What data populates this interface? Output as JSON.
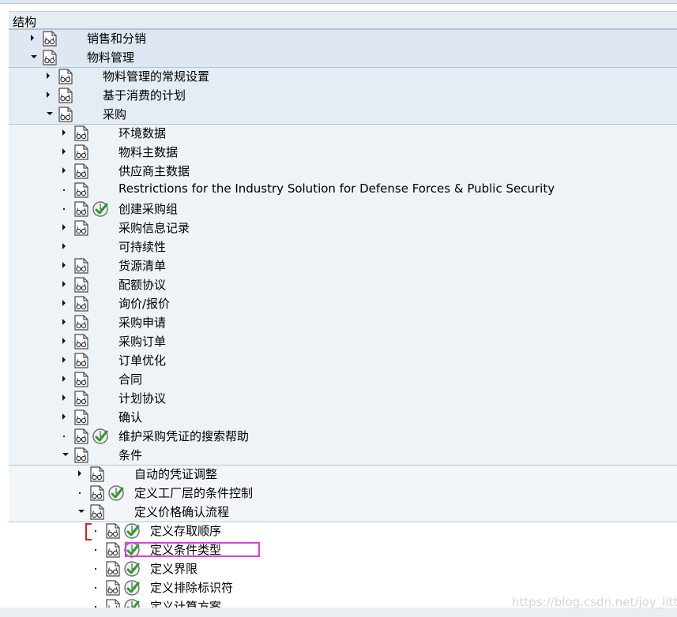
{
  "header": {
    "title": "结构"
  },
  "tree": [
    {
      "label": "销售和分销",
      "level": 0,
      "state": "collapsed",
      "check": false
    },
    {
      "label": "物料管理",
      "level": 0,
      "state": "expanded",
      "check": false
    },
    {
      "label": "物料管理的常规设置",
      "level": 1,
      "state": "collapsed",
      "check": false
    },
    {
      "label": "基于消费的计划",
      "level": 1,
      "state": "collapsed",
      "check": false
    },
    {
      "label": "采购",
      "level": 1,
      "state": "expanded",
      "check": false
    },
    {
      "label": "环境数据",
      "level": 2,
      "state": "collapsed",
      "check": false
    },
    {
      "label": "物料主数据",
      "level": 2,
      "state": "collapsed",
      "check": false
    },
    {
      "label": "供应商主数据",
      "level": 2,
      "state": "collapsed",
      "check": false
    },
    {
      "label": "Restrictions for the Industry Solution for Defense Forces & Public Security",
      "level": 2,
      "state": "leaf",
      "check": false
    },
    {
      "label": "创建采购组",
      "level": 2,
      "state": "leaf",
      "check": true
    },
    {
      "label": "采购信息记录",
      "level": 2,
      "state": "collapsed",
      "check": false
    },
    {
      "label": "可持续性",
      "level": 2,
      "state": "collapsed",
      "check": false,
      "noicon": true
    },
    {
      "label": "货源清单",
      "level": 2,
      "state": "collapsed",
      "check": false
    },
    {
      "label": "配额协议",
      "level": 2,
      "state": "collapsed",
      "check": false
    },
    {
      "label": "询价/报价",
      "level": 2,
      "state": "collapsed",
      "check": false
    },
    {
      "label": "采购申请",
      "level": 2,
      "state": "collapsed",
      "check": false
    },
    {
      "label": "采购订单",
      "level": 2,
      "state": "collapsed",
      "check": false
    },
    {
      "label": "订单优化",
      "level": 2,
      "state": "collapsed",
      "check": false
    },
    {
      "label": "合同",
      "level": 2,
      "state": "collapsed",
      "check": false
    },
    {
      "label": "计划协议",
      "level": 2,
      "state": "collapsed",
      "check": false
    },
    {
      "label": "确认",
      "level": 2,
      "state": "collapsed",
      "check": false
    },
    {
      "label": "维护采购凭证的搜索帮助",
      "level": 2,
      "state": "leaf",
      "check": true
    },
    {
      "label": "条件",
      "level": 2,
      "state": "expanded",
      "check": false
    },
    {
      "label": "自动的凭证调整",
      "level": 3,
      "state": "collapsed",
      "check": false
    },
    {
      "label": "定义工厂层的条件控制",
      "level": 3,
      "state": "leaf",
      "check": true
    },
    {
      "label": "定义价格确认流程",
      "level": 3,
      "state": "expanded",
      "check": false
    },
    {
      "label": "定义存取顺序",
      "level": 4,
      "state": "leaf",
      "check": true
    },
    {
      "label": "定义条件类型",
      "level": 4,
      "state": "leaf",
      "check": true
    },
    {
      "label": "定义界限",
      "level": 4,
      "state": "leaf",
      "check": true
    },
    {
      "label": "定义排除标识符",
      "level": 4,
      "state": "leaf",
      "check": true
    },
    {
      "label": "定义计算方案",
      "level": 4,
      "state": "leaf",
      "check": true
    }
  ],
  "watermark": "https://blog.csdn.net/joy_little",
  "colors": {
    "band0": "#dfe8f2",
    "band1": "#e4ecf4",
    "band2": "#eef3f8",
    "band3": "#f3f6f9",
    "band4": "#ffffff",
    "highlight": "#e23be0"
  }
}
